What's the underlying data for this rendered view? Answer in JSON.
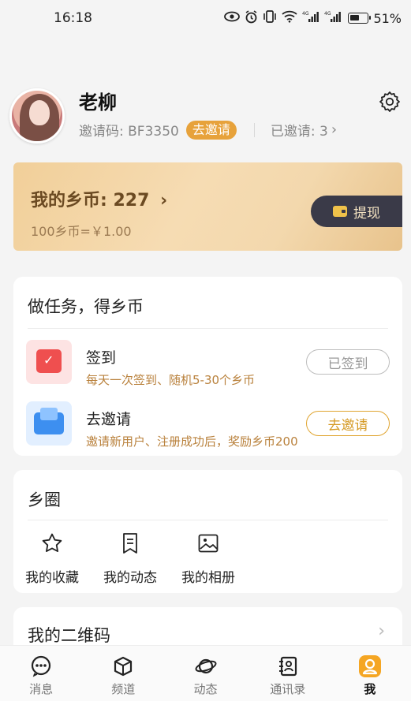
{
  "status_bar": {
    "time": "16:18",
    "net1": "4G",
    "net2": "4G",
    "battery": "51%"
  },
  "profile": {
    "username": "老柳",
    "invite_code_label": "邀请码: BF3350",
    "invite_button": "去邀请",
    "invited_label": "已邀请: 3",
    "chevron": "›"
  },
  "coins": {
    "title": "我的乡币: 227",
    "chevron": "›",
    "rate": "100乡币=￥1.00",
    "withdraw": "提现"
  },
  "tasks": {
    "title": "做任务，得乡币",
    "items": [
      {
        "name": "签到",
        "desc": "每天一次签到、随机5-30个乡币",
        "button": "已签到",
        "icon": "calendar-check-icon"
      },
      {
        "name": "去邀请",
        "desc": "邀请新用户、注册成功后，奖励乡币200",
        "button": "去邀请",
        "icon": "mail-invite-icon"
      }
    ]
  },
  "circle": {
    "title": "乡圈",
    "items": [
      {
        "label": "我的收藏",
        "icon": "star-icon"
      },
      {
        "label": "我的动态",
        "icon": "document-icon"
      },
      {
        "label": "我的相册",
        "icon": "image-icon"
      }
    ]
  },
  "qr": {
    "title": "我的二维码",
    "chevron": "›"
  },
  "tabbar": {
    "items": [
      {
        "label": "消息",
        "icon": "chat-icon"
      },
      {
        "label": "频道",
        "icon": "cube-icon"
      },
      {
        "label": "动态",
        "icon": "planet-icon"
      },
      {
        "label": "通讯录",
        "icon": "contacts-icon"
      },
      {
        "label": "我",
        "icon": "user-icon",
        "active": true
      }
    ]
  },
  "colors": {
    "accent": "#f5a623",
    "invite_pill": "#e7a23b",
    "withdraw_bg": "#3a3a48",
    "task_desc": "#b9813c"
  }
}
